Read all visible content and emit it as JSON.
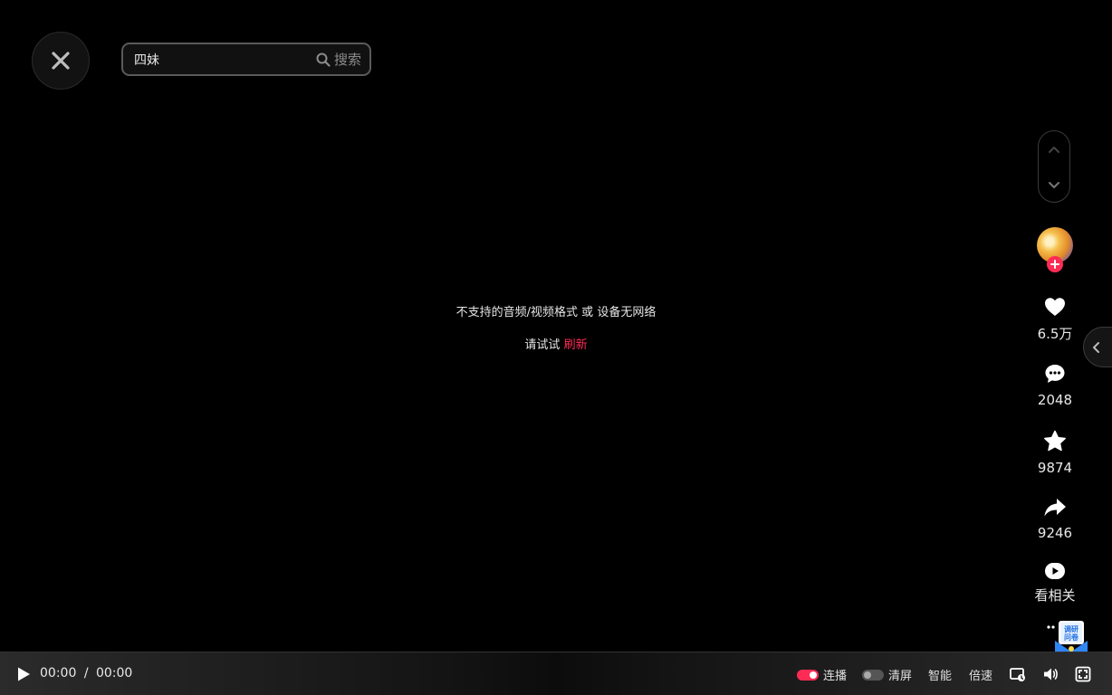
{
  "search": {
    "value": "四妹",
    "button_label": "搜索"
  },
  "error": {
    "message": "不支持的音频/视频格式 或 设备无网络",
    "retry_prefix": "请试试",
    "retry_link": "刷新"
  },
  "sidebar": {
    "likes": "6.5万",
    "comments": "2048",
    "favorites": "9874",
    "shares": "9246",
    "related_label": "看相关"
  },
  "survey_icon_text": "调研问卷",
  "player": {
    "current_time": "00:00",
    "separator": "/",
    "duration": "00:00",
    "autoplay_label": "连播",
    "autoplay_on": true,
    "clear_screen_label": "清屏",
    "clear_screen_on": false,
    "smart_label": "智能",
    "speed_label": "倍速"
  },
  "colors": {
    "accent": "#fe2c55",
    "background": "#000000"
  }
}
